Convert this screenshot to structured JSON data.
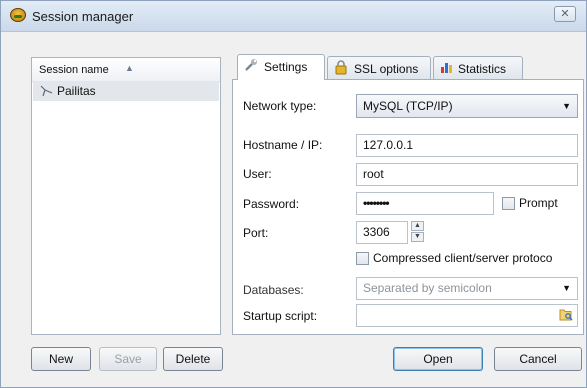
{
  "window": {
    "title": "Session manager",
    "close_glyph": "✕"
  },
  "session_list": {
    "column_header": "Session name",
    "sort_indicator": "▲",
    "sessions": [
      {
        "name": "Pailitas",
        "icon": "connection-icon"
      }
    ]
  },
  "tabs": [
    {
      "label": "Settings",
      "icon": "wrench-icon"
    },
    {
      "label": "SSL options",
      "icon": "lock-icon"
    },
    {
      "label": "Statistics",
      "icon": "bar-chart-icon"
    }
  ],
  "settings": {
    "network_type": {
      "label": "Network type:",
      "value": "MySQL (TCP/IP)"
    },
    "hostname": {
      "label": "Hostname / IP:",
      "value": "127.0.0.1"
    },
    "user": {
      "label": "User:",
      "value": "root"
    },
    "password": {
      "label": "Password:",
      "value": "••••••••",
      "prompt_label": "Prompt"
    },
    "port": {
      "label": "Port:",
      "value": "3306"
    },
    "compressed_label": "Compressed client/server protoco",
    "databases": {
      "label": "Databases:",
      "placeholder": "Separated by semicolon"
    },
    "startup_script": {
      "label": "Startup script:",
      "value": ""
    }
  },
  "buttons": {
    "new": "New",
    "save": "Save",
    "delete": "Delete",
    "open": "Open",
    "cancel": "Cancel"
  }
}
